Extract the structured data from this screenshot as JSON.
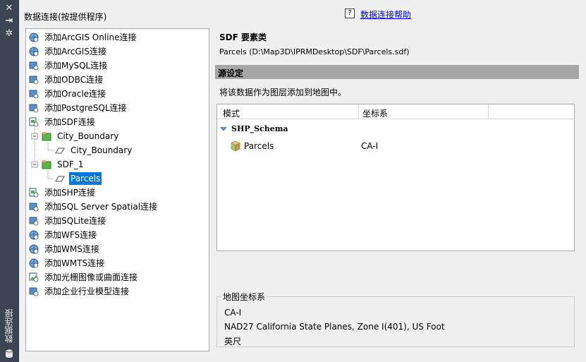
{
  "sidebar": {
    "close_icon": "✕",
    "pin_icon": "⇥",
    "settings_icon": "✲",
    "vertical_title": "数据连接"
  },
  "panel": {
    "title": "数据连接(按提供程序)"
  },
  "help": {
    "icon": "?",
    "link": "数据连接帮助"
  },
  "tree": {
    "items": [
      {
        "label": "添加ArcGIS Online连接",
        "icon": "globe-icon"
      },
      {
        "label": "添加ArcGIS连接",
        "icon": "globe-icon"
      },
      {
        "label": "添加MySQL连接",
        "icon": "db-connect-icon"
      },
      {
        "label": "添加ODBC连接",
        "icon": "db-connect-icon"
      },
      {
        "label": "添加Oracle连接",
        "icon": "db-connect-icon"
      },
      {
        "label": "添加PostgreSQL连接",
        "icon": "db-connect-icon"
      },
      {
        "label": "添加SDF连接",
        "icon": "file-connect-icon"
      },
      {
        "label": "City_Boundary",
        "icon": "folder-green-icon"
      },
      {
        "label": "City_Boundary",
        "icon": "polygon-icon"
      },
      {
        "label": "SDF_1",
        "icon": "folder-green-icon"
      },
      {
        "label": "Parcels",
        "icon": "polygon-icon"
      },
      {
        "label": "添加SHP连接",
        "icon": "file-connect-icon"
      },
      {
        "label": "添加SQL Server Spatial连接",
        "icon": "db-connect-icon"
      },
      {
        "label": "添加SQLite连接",
        "icon": "db-connect-icon"
      },
      {
        "label": "添加WFS连接",
        "icon": "globe-icon"
      },
      {
        "label": "添加WMS连接",
        "icon": "globe-icon"
      },
      {
        "label": "添加WMTS连接",
        "icon": "globe-icon"
      },
      {
        "label": "添加光栅图像或曲面连接",
        "icon": "image-connect-icon"
      },
      {
        "label": "添加企业行业模型连接",
        "icon": "db-connect-icon"
      }
    ]
  },
  "detail": {
    "title": "SDF 要素类",
    "path": "Parcels (D:\\Map3D\\IPRMDesktop\\SDF\\Parcels.sdf)",
    "section": "源设定",
    "description": "将该数据作为图层添加到地图中。",
    "grid": {
      "col_schema": "模式",
      "col_cs": "坐标系",
      "schema_name": "SHP_Schema",
      "feature_name": "Parcels",
      "feature_cs": "CA-I"
    },
    "map_cs": {
      "label": "地图坐标系",
      "code": "CA-I",
      "description": "NAD27 California State Planes, Zone I(401), US Foot",
      "unit": "英尺"
    }
  }
}
